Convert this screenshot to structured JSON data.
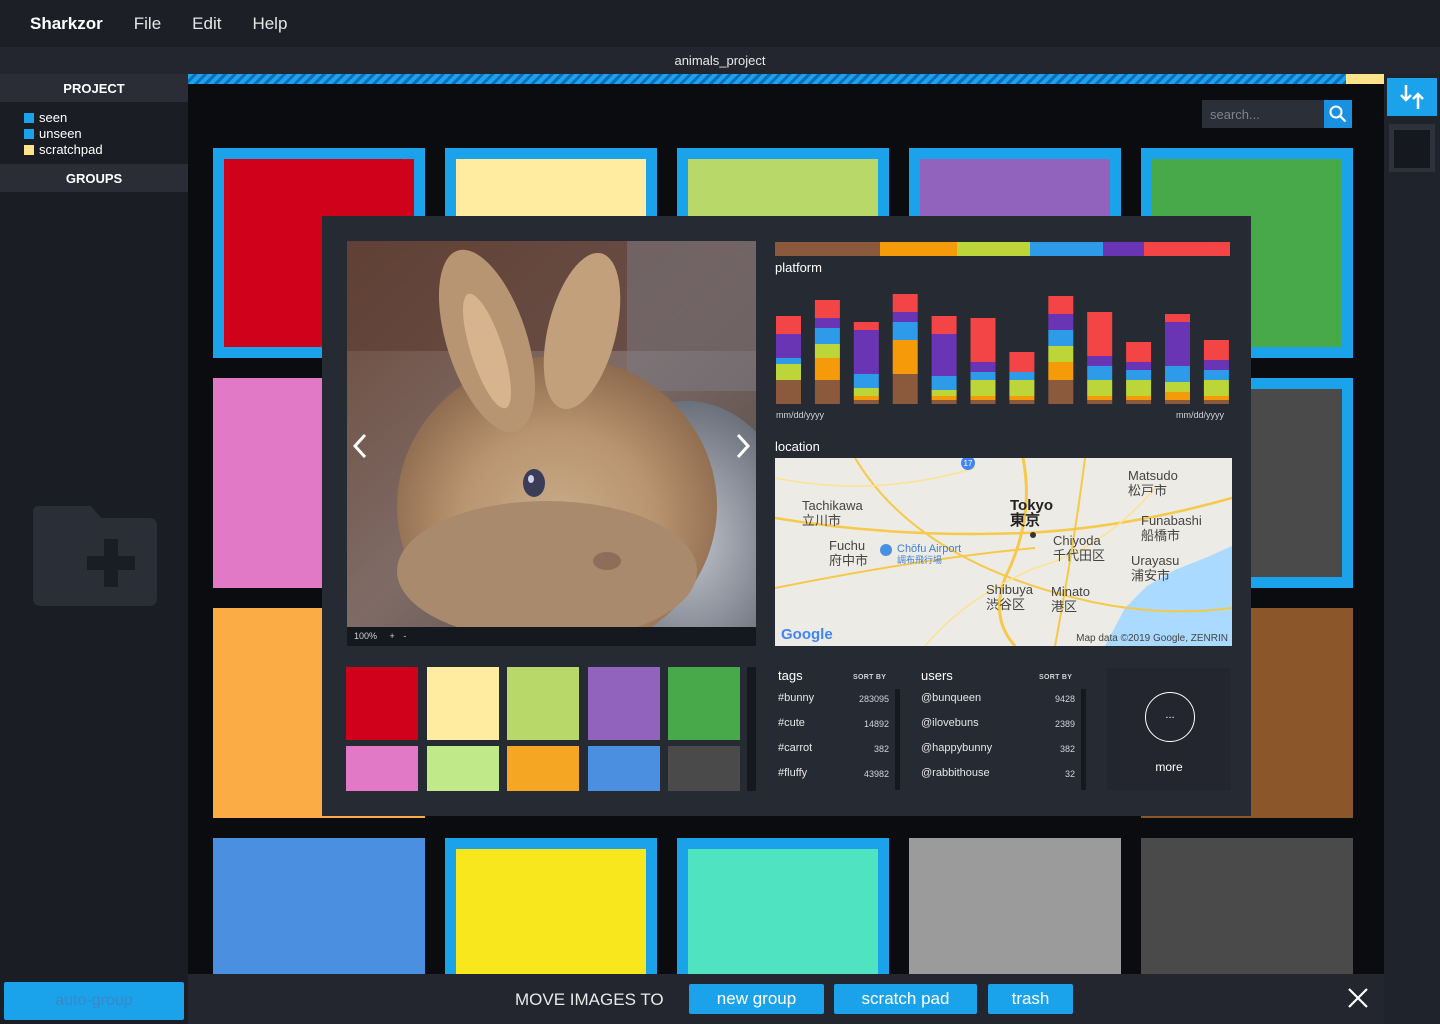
{
  "app": {
    "brand": "Sharkzor",
    "menus": [
      "File",
      "Edit",
      "Help"
    ],
    "window_title": "animals_project"
  },
  "sidebar": {
    "project_heading": "PROJECT",
    "filters": [
      {
        "label": "seen",
        "color": "#1aa3ea"
      },
      {
        "label": "unseen",
        "color": "#1aa3ea"
      },
      {
        "label": "scratchpad",
        "color": "#ffe38a"
      }
    ],
    "groups_heading": "GROUPS",
    "auto_group": "auto-group"
  },
  "search": {
    "placeholder": "search..."
  },
  "progress": {
    "fraction": 0.968
  },
  "grid": {
    "tiles": [
      {
        "row": 0,
        "col": 0,
        "color": "#d0021b",
        "frame": "#1aa3ea"
      },
      {
        "row": 0,
        "col": 1,
        "color": "#ffeca0",
        "frame": "#1aa3ea"
      },
      {
        "row": 0,
        "col": 2,
        "color": "#b8d96a",
        "frame": "#1aa3ea"
      },
      {
        "row": 0,
        "col": 3,
        "color": "#9163bd",
        "frame": "#1aa3ea"
      },
      {
        "row": 0,
        "col": 4,
        "color": "#47a94a",
        "frame": "#1aa3ea"
      },
      {
        "row": 1,
        "col": 0,
        "color": "#e279c6",
        "frame": "#e279c6"
      },
      {
        "row": 1,
        "col": 4,
        "color": "#4a4a4a",
        "frame": "#1aa3ea"
      },
      {
        "row": 2,
        "col": 0,
        "color": "#fbac45",
        "frame": "#fbac45"
      },
      {
        "row": 2,
        "col": 4,
        "color": "#8b572a",
        "frame": "#8b572a"
      },
      {
        "row": 3,
        "col": 0,
        "color": "#4a8fe0",
        "frame": "#4a8fe0"
      },
      {
        "row": 3,
        "col": 1,
        "color": "#f8e71c",
        "frame": "#1aa3ea"
      },
      {
        "row": 3,
        "col": 2,
        "color": "#50e3c2",
        "frame": "#1aa3ea"
      },
      {
        "row": 3,
        "col": 3,
        "color": "#9b9b9b",
        "frame": "#9b9b9b"
      },
      {
        "row": 3,
        "col": 4,
        "color": "#4a4a4a",
        "frame": "#4a4a4a"
      }
    ]
  },
  "modal": {
    "zoom": "100%",
    "zoom_in": "+",
    "zoom_out": "-",
    "platform_title": "platform",
    "platform_colors": [
      {
        "color": "#8b5a3c",
        "share": 0.23
      },
      {
        "color": "#f59b0a",
        "share": 0.17
      },
      {
        "color": "#bcd63a",
        "share": 0.16
      },
      {
        "color": "#2d9be8",
        "share": 0.16
      },
      {
        "color": "#6a35b5",
        "share": 0.09
      },
      {
        "color": "#f34545",
        "share": 0.19
      }
    ],
    "chart_axis_start": "mm/dd/yyyy",
    "chart_axis_end": "mm/dd/yyyy",
    "location_title": "location",
    "map": {
      "labels": [
        {
          "en": "Tachikawa",
          "ja": "立川市"
        },
        {
          "en": "Tokyo",
          "ja": "東京"
        },
        {
          "en": "Matsudo",
          "ja": "松戸市"
        },
        {
          "en": "Funabashi",
          "ja": "船橋市"
        },
        {
          "en": "Chiyoda",
          "ja": "千代田区"
        },
        {
          "en": "Fuchu",
          "ja": "府中市"
        },
        {
          "en": "Chōfu Airport",
          "ja": "調布飛行場"
        },
        {
          "en": "Urayasu",
          "ja": "浦安市"
        },
        {
          "en": "Shibuya",
          "ja": "渋谷区"
        },
        {
          "en": "Minato",
          "ja": "港区"
        }
      ],
      "route_badge": "17",
      "attribution": "Map data ©2019 Google, ZENRIN",
      "logo": "Google"
    },
    "swatches": [
      "#d0021b",
      "#ffeca0",
      "#b8d96a",
      "#9163bd",
      "#47a94a",
      "#e279c6",
      "#c0ea89",
      "#f5a623",
      "#4a8fe0",
      "#4a4a4a"
    ],
    "tags": {
      "title": "tags",
      "sort": "SORT BY",
      "items": [
        {
          "name": "#bunny",
          "count": "283095"
        },
        {
          "name": "#cute",
          "count": "14892"
        },
        {
          "name": "#carrot",
          "count": "382"
        },
        {
          "name": "#fluffy",
          "count": "43982"
        }
      ]
    },
    "users": {
      "title": "users",
      "sort": "SORT BY",
      "items": [
        {
          "name": "@bunqueen",
          "count": "9428"
        },
        {
          "name": "@ilovebuns",
          "count": "2389"
        },
        {
          "name": "@happybunny",
          "count": "382"
        },
        {
          "name": "@rabbithouse",
          "count": "32"
        }
      ]
    },
    "more": {
      "glyph": "...",
      "label": "more"
    }
  },
  "bottom": {
    "move_label": "MOVE IMAGES TO",
    "new_group": "new group",
    "scratch_pad": "scratch pad",
    "trash": "trash"
  },
  "chart_data": {
    "type": "bar",
    "title": "platform",
    "xlabel": "",
    "ylabel": "",
    "x_start": "mm/dd/yyyy",
    "x_end": "mm/dd/yyyy",
    "series_colors": [
      "#8b5a3c",
      "#f59b0a",
      "#bcd63a",
      "#2d9be8",
      "#6a35b5",
      "#f34545"
    ],
    "stacks": [
      [
        24,
        0,
        16,
        6,
        24,
        18
      ],
      [
        24,
        22,
        14,
        16,
        10,
        18
      ],
      [
        4,
        4,
        8,
        14,
        44,
        8
      ],
      [
        30,
        34,
        0,
        18,
        10,
        18
      ],
      [
        4,
        4,
        6,
        14,
        42,
        18
      ],
      [
        4,
        4,
        16,
        8,
        10,
        44
      ],
      [
        4,
        4,
        16,
        8,
        0,
        20
      ],
      [
        24,
        18,
        16,
        16,
        16,
        18
      ],
      [
        4,
        4,
        16,
        14,
        10,
        44
      ],
      [
        4,
        4,
        16,
        10,
        8,
        20
      ],
      [
        4,
        8,
        10,
        16,
        44,
        8
      ],
      [
        4,
        4,
        16,
        10,
        10,
        20
      ]
    ],
    "grid": false
  }
}
